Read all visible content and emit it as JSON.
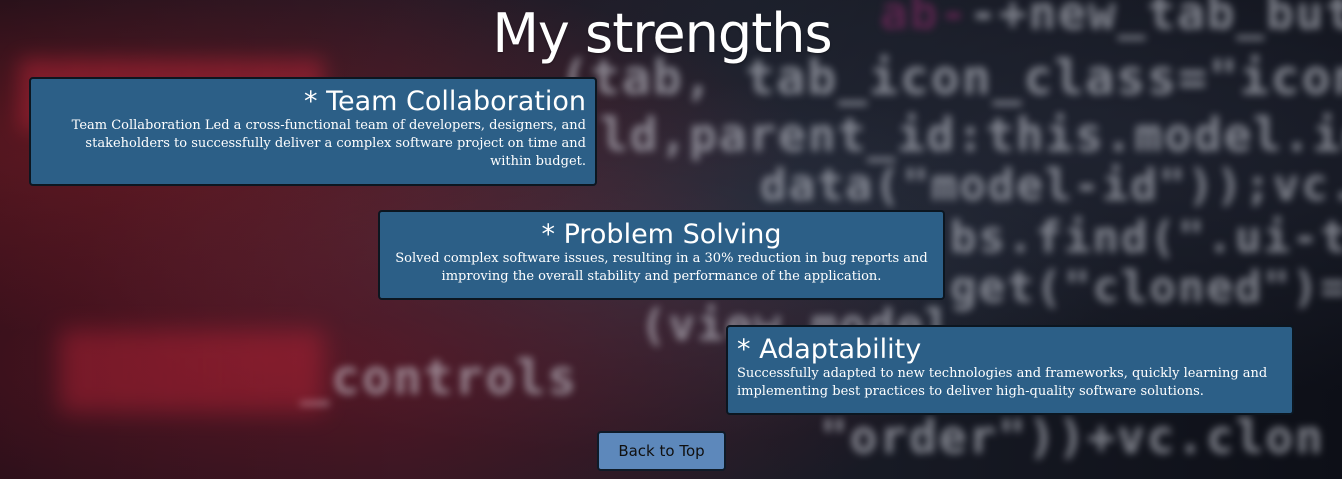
{
  "page": {
    "title": "My strengths"
  },
  "strengths": [
    {
      "title": "* Team Collaboration",
      "description": "Team Collaboration Led a cross-functional team of developers, designers, and stakeholders to successfully deliver a complex software project on time and within budget."
    },
    {
      "title": "* Problem Solving",
      "description": "Solved complex software issues, resulting in a 30% reduction in bug reports and improving the overall stability and performance of the application."
    },
    {
      "title": "* Adaptability",
      "description": "Successfully adapted to new technologies and frameworks, quickly learning and implementing best practices to deliver high-quality software solutions."
    }
  ],
  "back_to_top": {
    "label": "Back to Top"
  },
  "background_code": {
    "lines": [
      "-+new_tab_button_",
      "tab_icon_class=\"icon-cog\"",
      ",parent_id:this.model.id})",
      "data(\"model-id\"));vc.st",
      "bs.find(\".ui-tabs",
      "get(\"cloned\")===",
      "(view.model.",
      "_controls",
      "\"order\"))+vc.clon"
    ]
  },
  "colors": {
    "card_background": "#2c5f87",
    "button_background": "#5d88bb",
    "title_color": "#ffffff"
  }
}
